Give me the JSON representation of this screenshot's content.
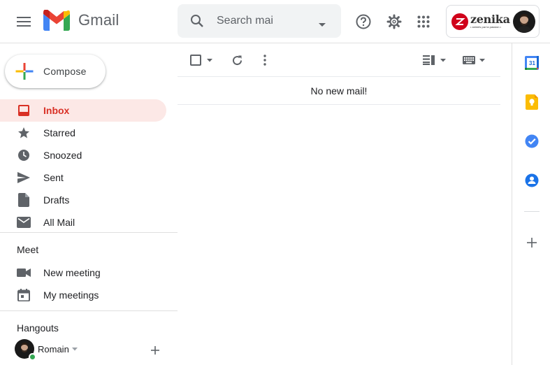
{
  "header": {
    "menu_icon": "hamburger-menu-icon",
    "app_name": "Gmail",
    "search_placeholder": "Search mai",
    "account_org": "zenika",
    "account_tagline": "• animés par la passion •"
  },
  "compose": {
    "label": "Compose"
  },
  "nav": {
    "items": [
      {
        "label": "Inbox",
        "icon": "inbox-icon",
        "active": true
      },
      {
        "label": "Starred",
        "icon": "star-icon"
      },
      {
        "label": "Snoozed",
        "icon": "clock-icon"
      },
      {
        "label": "Sent",
        "icon": "send-icon"
      },
      {
        "label": "Drafts",
        "icon": "draft-icon"
      },
      {
        "label": "All Mail",
        "icon": "mail-icon"
      }
    ]
  },
  "meet": {
    "title": "Meet",
    "items": [
      {
        "label": "New meeting",
        "icon": "video-camera-icon"
      },
      {
        "label": "My meetings",
        "icon": "calendar-icon"
      }
    ]
  },
  "hangouts": {
    "title": "Hangouts",
    "user_name": "Romain",
    "status": "online"
  },
  "main": {
    "empty_message": "No new mail!"
  },
  "side_panel": {
    "calendar_day": "31",
    "apps": [
      "calendar-icon",
      "keep-icon",
      "tasks-icon",
      "contacts-icon",
      "add-icon"
    ]
  },
  "colors": {
    "accent_red": "#d93025",
    "active_bg": "#fce8e6",
    "online_green": "#34a853"
  }
}
